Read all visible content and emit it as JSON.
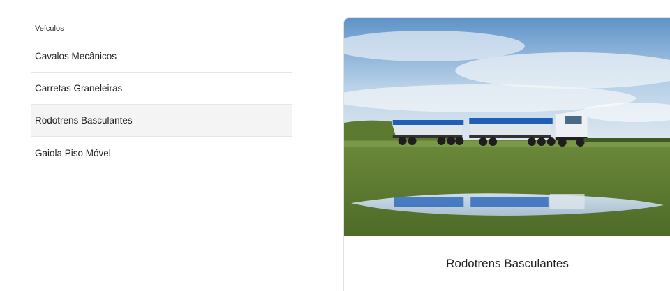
{
  "menu": {
    "heading": "Veículos",
    "items": [
      {
        "label": "Cavalos Mecânicos"
      },
      {
        "label": "Carretas Graneleiras"
      },
      {
        "label": "Rodotrens Basculantes"
      },
      {
        "label": "Gaiola Piso Móvel"
      }
    ]
  },
  "card": {
    "image": "truck-rodotrem-photo",
    "title": "Rodotrens Basculantes"
  },
  "colors": {
    "active_bg": "#f4f4f4",
    "divider": "#e6e6e6",
    "trailer_blue": "#1f5fb8"
  }
}
